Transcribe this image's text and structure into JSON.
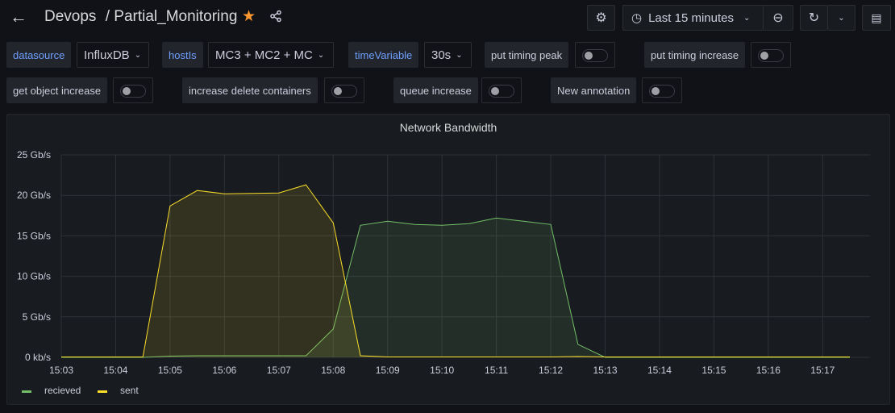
{
  "header": {
    "folder": "Devops",
    "separator": "/",
    "dashboard": "Partial_Monitoring",
    "time_range": "Last 15 minutes"
  },
  "variables": [
    {
      "label": "datasource",
      "value": "InfluxDB"
    },
    {
      "label": "hostIs",
      "value": "MC3 + MC2 + MC"
    },
    {
      "label": "timeVariable",
      "value": "30s"
    }
  ],
  "toggles": [
    {
      "label": "put timing peak",
      "on": false
    },
    {
      "label": "put timing increase",
      "on": false
    },
    {
      "label": "get object increase",
      "on": false
    },
    {
      "label": "increase delete containers",
      "on": false
    },
    {
      "label": "queue increase",
      "on": false
    },
    {
      "label": "New annotation",
      "on": false
    }
  ],
  "colors": {
    "recieved": "#73bf69",
    "sent": "#fade2a",
    "accent": "#6e9fff",
    "star": "#ff9830"
  },
  "chart_data": {
    "type": "area",
    "title": "Network Bandwidth",
    "x": [
      "15:03:00",
      "15:03:30",
      "15:04:00",
      "15:04:30",
      "15:05:00",
      "15:05:30",
      "15:06:00",
      "15:06:30",
      "15:07:00",
      "15:07:30",
      "15:08:00",
      "15:08:30",
      "15:09:00",
      "15:09:30",
      "15:10:00",
      "15:10:30",
      "15:11:00",
      "15:11:30",
      "15:12:00",
      "15:12:30",
      "15:13:00",
      "15:13:30",
      "15:14:00",
      "15:14:30",
      "15:15:00",
      "15:15:30",
      "15:16:00",
      "15:16:30",
      "15:17:00",
      "15:17:30"
    ],
    "series": [
      {
        "name": "recieved",
        "color": "#73bf69",
        "values": [
          0,
          0,
          0,
          0,
          0.15,
          0.2,
          0.2,
          0.2,
          0.2,
          0.2,
          3.5,
          16.3,
          16.8,
          16.4,
          16.3,
          16.5,
          17.2,
          16.8,
          16.4,
          1.6,
          0,
          0,
          0,
          0,
          0,
          0,
          0,
          0,
          0,
          0
        ]
      },
      {
        "name": "sent",
        "color": "#fade2a",
        "values": [
          0.05,
          0.05,
          0.05,
          0.05,
          18.7,
          20.6,
          20.2,
          20.25,
          20.3,
          21.3,
          16.6,
          0.2,
          0.05,
          0.05,
          0.05,
          0.05,
          0.05,
          0.05,
          0.05,
          0.1,
          0.05,
          0.05,
          0.05,
          0.05,
          0.05,
          0.05,
          0.05,
          0.05,
          0.05,
          0.05
        ]
      }
    ],
    "yticks": [
      "0 kb/s",
      "5 Gb/s",
      "10 Gb/s",
      "15 Gb/s",
      "20 Gb/s",
      "25 Gb/s"
    ],
    "ylim": [
      0,
      25
    ],
    "xticks": [
      "15:03",
      "15:04",
      "15:05",
      "15:06",
      "15:07",
      "15:08",
      "15:09",
      "15:10",
      "15:11",
      "15:12",
      "15:13",
      "15:14",
      "15:15",
      "15:16",
      "15:17"
    ],
    "xlim_minutes": [
      0,
      14.87
    ],
    "grid": true,
    "legend": "bottom-left"
  }
}
